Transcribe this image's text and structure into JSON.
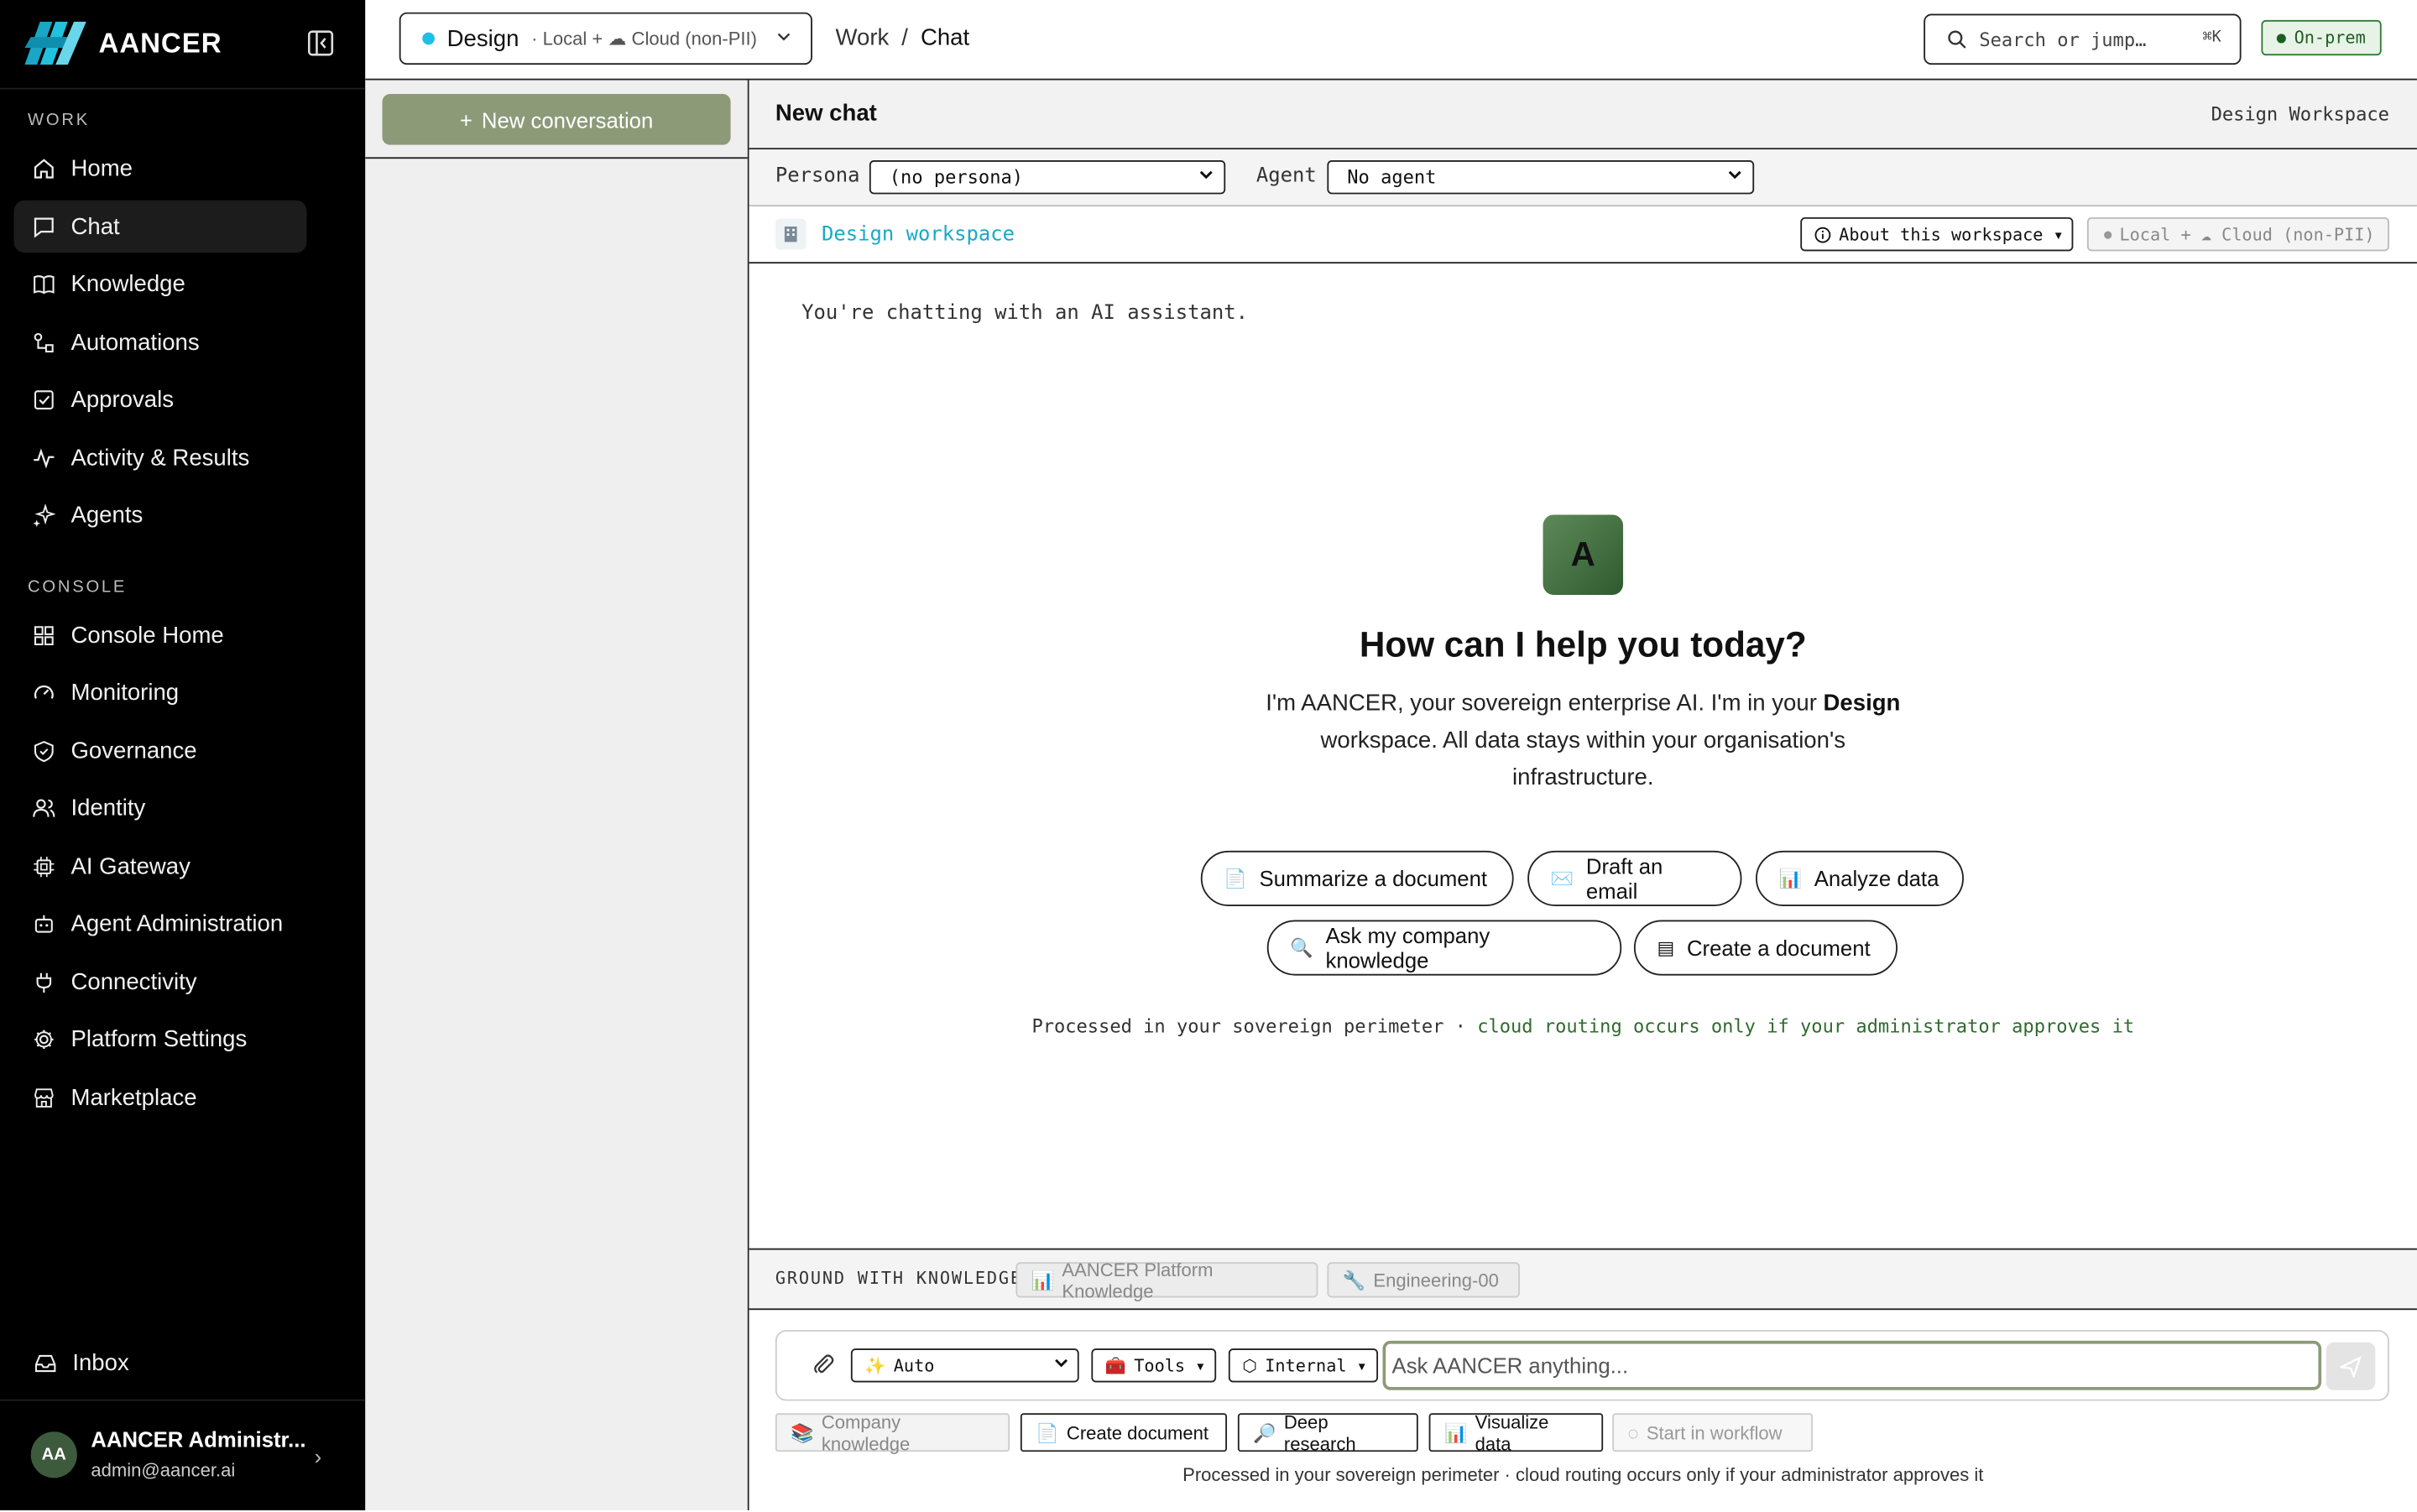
{
  "brand": {
    "name": "AANCER"
  },
  "sidebar": {
    "sections": [
      {
        "label": "WORK",
        "items": [
          "Home",
          "Chat",
          "Knowledge",
          "Automations",
          "Approvals",
          "Activity & Results",
          "Agents"
        ]
      },
      {
        "label": "CONSOLE",
        "items": [
          "Console Home",
          "Monitoring",
          "Governance",
          "Identity",
          "AI Gateway",
          "Agent Administration",
          "Connectivity",
          "Platform Settings",
          "Marketplace"
        ]
      }
    ],
    "active_item": "Chat",
    "inbox": "Inbox",
    "user": {
      "initials": "AA",
      "name": "AANCER Administr...",
      "email": "admin@aancer.ai"
    }
  },
  "topbar": {
    "workspace": "Design",
    "workspace_mode": "· Local + ☁ Cloud (non-PII)",
    "breadcrumb_parent": "Work",
    "breadcrumb_sep": "/",
    "breadcrumb_current": "Chat",
    "search_placeholder": "Search or jump…",
    "search_shortcut": "⌘K",
    "env_badge": "On-prem"
  },
  "conversations": {
    "new_button": "New conversation"
  },
  "chat": {
    "title": "New chat",
    "workspace_label": "Design Workspace",
    "persona_label": "Persona",
    "persona_value": "(no persona)",
    "agent_label": "Agent",
    "agent_value": "No agent",
    "workspace_link": "Design workspace",
    "about_button": "About this workspace ▾",
    "routing_badge": "Local + ☁ Cloud (non-PII)",
    "intro": "You're chatting with an AI assistant.",
    "hero_avatar": "A",
    "hero_title": "How can I help you today?",
    "hero_desc_1": "I'm AANCER, your sovereign enterprise AI. I'm in your ",
    "hero_desc_ws": "Design",
    "hero_desc_2": " workspace. All data stays within your organisation's infrastructure.",
    "suggestions": [
      "Summarize a document",
      "Draft an email",
      "Analyze data",
      "Ask my company knowledge",
      "Create a document"
    ],
    "suggestion_icons": [
      "📄",
      "✉️",
      "📊",
      "🔍",
      "▤"
    ],
    "perimeter_1": "Processed in your sovereign perimeter · ",
    "perimeter_2": "cloud routing occurs only if your administrator approves it",
    "ground_label": "GROUND WITH KNOWLEDGE",
    "knowledge_chips": [
      "AANCER Platform Knowledge",
      "Engineering-00"
    ],
    "knowledge_icons": [
      "📊",
      "🔧"
    ],
    "composer": {
      "model": "Auto",
      "tools": "Tools ▾",
      "classification": "Internal ▾",
      "placeholder": "Ask AANCER anything..."
    },
    "actions": [
      "Company knowledge",
      "Create document",
      "Deep research",
      "Visualize data",
      "Start in workflow"
    ],
    "action_icons": [
      "📚",
      "📄",
      "🔎",
      "📊",
      "◌"
    ],
    "footer": "Processed in your sovereign perimeter · cloud routing occurs only if your administrator approves it"
  },
  "colors": {
    "accent": "#8c9a78",
    "link": "#18a9c7",
    "status_dot": "#1cc0e6",
    "onprem": "#2e7d32"
  }
}
